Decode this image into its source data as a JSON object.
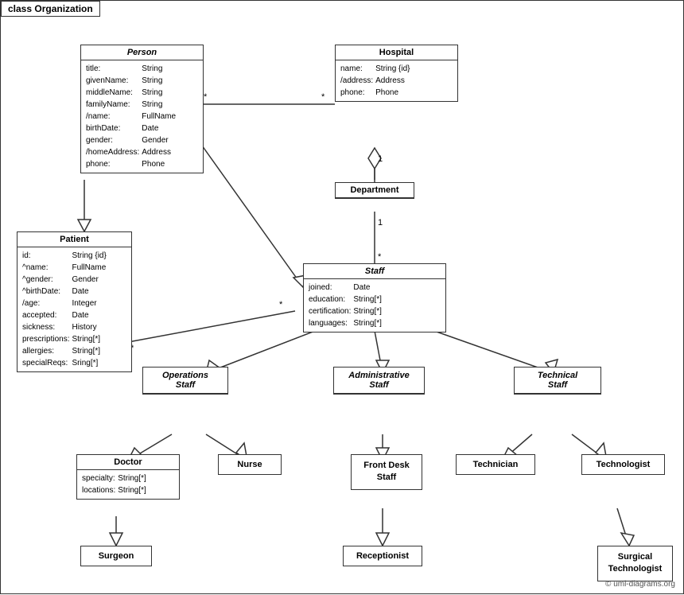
{
  "title": "class Organization",
  "classes": {
    "person": {
      "name": "Person",
      "italic": true,
      "attributes": [
        [
          "title:",
          "String"
        ],
        [
          "givenName:",
          "String"
        ],
        [
          "middleName:",
          "String"
        ],
        [
          "familyName:",
          "String"
        ],
        [
          "/name:",
          "FullName"
        ],
        [
          "birthDate:",
          "Date"
        ],
        [
          "gender:",
          "Gender"
        ],
        [
          "/homeAddress:",
          "Address"
        ],
        [
          "phone:",
          "Phone"
        ]
      ]
    },
    "hospital": {
      "name": "Hospital",
      "italic": false,
      "attributes": [
        [
          "name:",
          "String {id}"
        ],
        [
          "/address:",
          "Address"
        ],
        [
          "phone:",
          "Phone"
        ]
      ]
    },
    "patient": {
      "name": "Patient",
      "italic": false,
      "attributes": [
        [
          "id:",
          "String {id}"
        ],
        [
          "^name:",
          "FullName"
        ],
        [
          "^gender:",
          "Gender"
        ],
        [
          "^birthDate:",
          "Date"
        ],
        [
          "/age:",
          "Integer"
        ],
        [
          "accepted:",
          "Date"
        ],
        [
          "sickness:",
          "History"
        ],
        [
          "prescriptions:",
          "String[*]"
        ],
        [
          "allergies:",
          "String[*]"
        ],
        [
          "specialReqs:",
          "Sring[*]"
        ]
      ]
    },
    "department": {
      "name": "Department",
      "italic": false
    },
    "staff": {
      "name": "Staff",
      "italic": true,
      "attributes": [
        [
          "joined:",
          "Date"
        ],
        [
          "education:",
          "String[*]"
        ],
        [
          "certification:",
          "String[*]"
        ],
        [
          "languages:",
          "String[*]"
        ]
      ]
    },
    "operations_staff": {
      "name": "Operations\nStaff",
      "italic": true
    },
    "administrative_staff": {
      "name": "Administrative\nStaff",
      "italic": true
    },
    "technical_staff": {
      "name": "Technical\nStaff",
      "italic": true
    },
    "doctor": {
      "name": "Doctor",
      "italic": false,
      "attributes": [
        [
          "specialty:",
          "String[*]"
        ],
        [
          "locations:",
          "String[*]"
        ]
      ]
    },
    "nurse": {
      "name": "Nurse",
      "italic": false
    },
    "front_desk_staff": {
      "name": "Front Desk\nStaff",
      "italic": false
    },
    "technician": {
      "name": "Technician",
      "italic": false
    },
    "technologist": {
      "name": "Technologist",
      "italic": false
    },
    "surgeon": {
      "name": "Surgeon",
      "italic": false
    },
    "receptionist": {
      "name": "Receptionist",
      "italic": false
    },
    "surgical_technologist": {
      "name": "Surgical\nTechnologist",
      "italic": false
    }
  },
  "copyright": "© uml-diagrams.org"
}
